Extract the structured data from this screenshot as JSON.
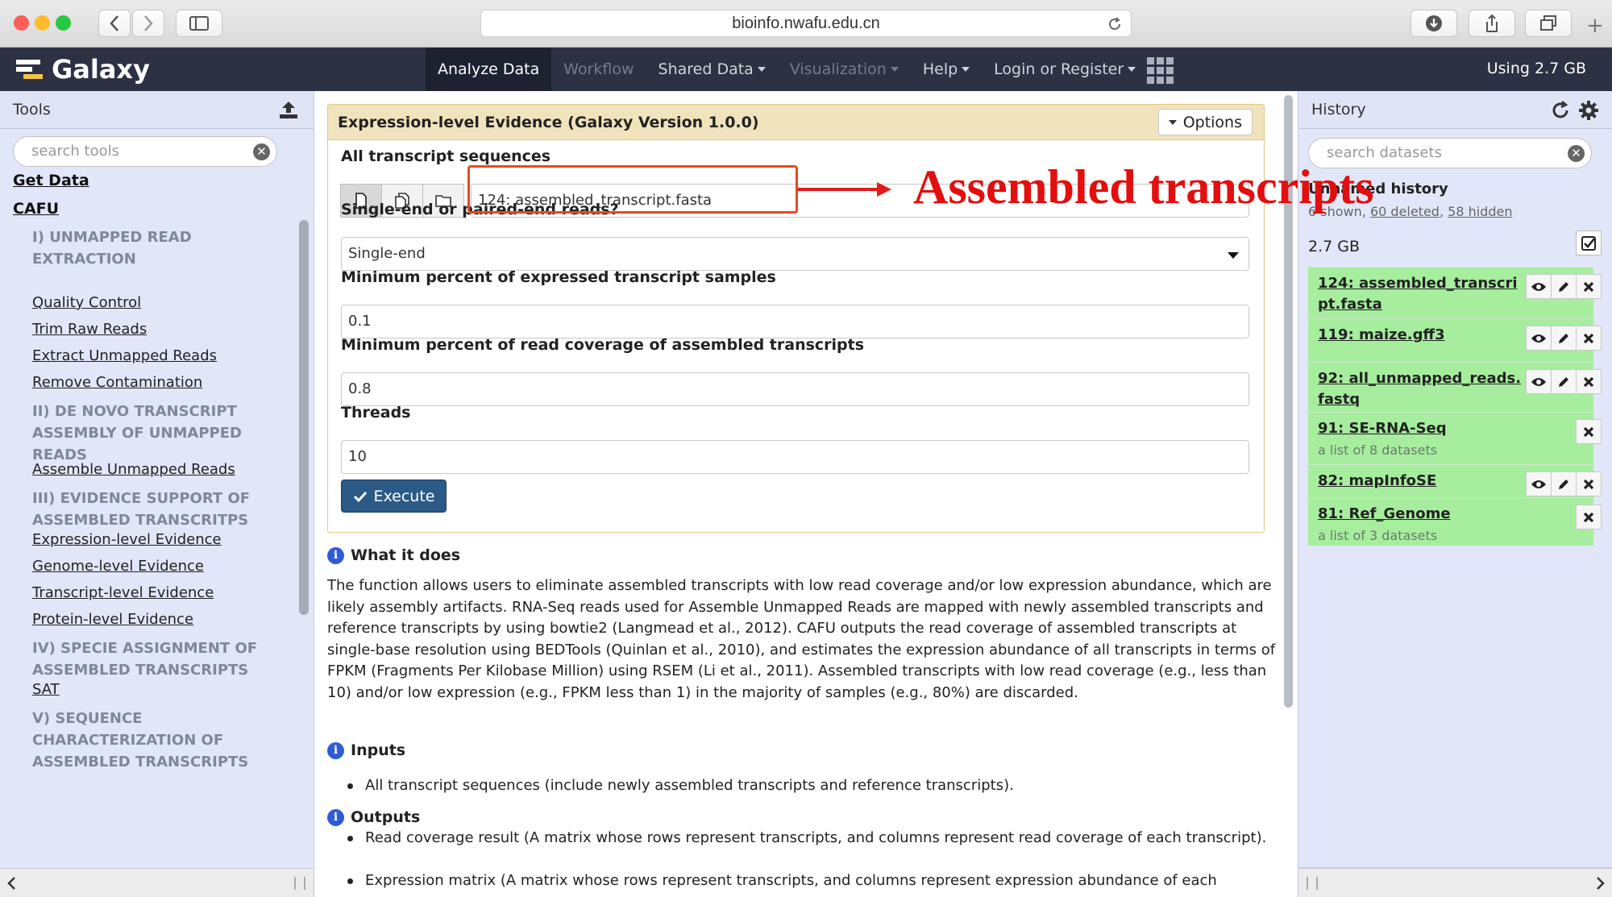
{
  "browser": {
    "url": "bioinfo.nwafu.edu.cn",
    "colors": {
      "close": "#fc5f57",
      "minimize": "#fdbc2e",
      "zoom": "#28c840"
    }
  },
  "navbar": {
    "brand": "Galaxy",
    "items": [
      {
        "label": "Analyze Data",
        "state": "active",
        "dropdown": false
      },
      {
        "label": "Workflow",
        "state": "disabled",
        "dropdown": false
      },
      {
        "label": "Shared Data",
        "state": "normal",
        "dropdown": true
      },
      {
        "label": "Visualization",
        "state": "disabled",
        "dropdown": true
      },
      {
        "label": "Help",
        "state": "normal",
        "dropdown": true
      },
      {
        "label": "Login or Register",
        "state": "normal",
        "dropdown": true
      }
    ],
    "quota": "Using 2.7 GB"
  },
  "tools_panel": {
    "title": "Tools",
    "search_placeholder": "search tools",
    "items": [
      {
        "kind": "header",
        "label": "Get Data"
      },
      {
        "kind": "header",
        "label": "CAFU"
      },
      {
        "kind": "section",
        "label": "I) UNMAPPED READ EXTRACTION"
      },
      {
        "kind": "tool",
        "label": "Quality Control"
      },
      {
        "kind": "tool",
        "label": "Trim Raw Reads"
      },
      {
        "kind": "tool",
        "label": "Extract Unmapped Reads"
      },
      {
        "kind": "tool",
        "label": "Remove Contamination"
      },
      {
        "kind": "section",
        "label": "II) DE NOVO TRANSCRIPT ASSEMBLY OF UNMAPPED READS"
      },
      {
        "kind": "tool",
        "label": "Assemble Unmapped Reads"
      },
      {
        "kind": "section",
        "label": "III) EVIDENCE SUPPORT OF ASSEMBLED TRANSCRITPS"
      },
      {
        "kind": "tool",
        "label": "Expression-level Evidence"
      },
      {
        "kind": "tool",
        "label": "Genome-level Evidence"
      },
      {
        "kind": "tool",
        "label": "Transcript-level Evidence"
      },
      {
        "kind": "tool",
        "label": "Protein-level Evidence"
      },
      {
        "kind": "section",
        "label": "IV) SPECIE ASSIGNMENT OF ASSEMBLED TRANSCRIPTS"
      },
      {
        "kind": "tool",
        "label": "SAT"
      },
      {
        "kind": "section",
        "label": "V) SEQUENCE CHARACTERIZATION OF ASSEMBLED TRANSCRIPTS"
      }
    ]
  },
  "tool_form": {
    "title": "Expression-level Evidence (Galaxy Version 1.0.0)",
    "options_label": "Options",
    "fields": [
      {
        "label": "All transcript sequences",
        "value": "124: assembled_transcript.fasta"
      },
      {
        "label": "Single-end or paired-end reads?",
        "value": "Single-end"
      },
      {
        "label": "Minimum percent of expressed transcript samples",
        "value": "0.1"
      },
      {
        "label": "Minimum percent of read coverage of assembled transcripts",
        "value": "0.8"
      },
      {
        "label": "Threads",
        "value": "10"
      }
    ],
    "execute_label": "Execute"
  },
  "annotation": {
    "text": "Assembled transcripts",
    "color": "#e30e0e"
  },
  "help": {
    "what_title": "What it does",
    "description": "The function allows users to eliminate assembled transcripts with low read coverage and/or low expression abundance, which are likely assembly artifacts. RNA-Seq reads used for Assemble Unmapped Reads are mapped with newly assembled transcripts and reference transcripts by using bowtie2 (Langmead et al., 2012). CAFU outputs the read coverage of assembled transcripts at single-base resolution using BEDTools (Quinlan et al., 2010), and estimates the expression abundance of all transcripts in terms of FPKM (Fragments Per Kilobase Million) using RSEM (Li et al., 2011). Assembled transcripts with low read coverage (e.g., less than 10) and/or low expression (e.g., FPKM less than 1) in the majority of samples (e.g., 80%) are discarded.",
    "inputs_title": "Inputs",
    "inputs": [
      "All transcript sequences (include newly assembled transcripts and reference transcripts)."
    ],
    "outputs_title": "Outputs",
    "outputs": [
      "Read coverage result (A matrix whose rows represent transcripts, and columns represent read coverage of each transcript).",
      "Expression matrix (A matrix whose rows represent transcripts, and columns represent expression abundance of each"
    ]
  },
  "history_panel": {
    "title": "History",
    "search_placeholder": "search datasets",
    "history_name": "Unnamed history",
    "counts": {
      "shown": "6 shown,",
      "deleted": "60 deleted",
      "sep": ",",
      "hidden": "58 hidden"
    },
    "size": "2.7 GB",
    "items_color": "#a6ee9e",
    "items": [
      {
        "name_line1": "124: assembled_transcri",
        "name_line2": "pt.fasta",
        "subtitle": "",
        "actions": [
          "eye-icon",
          "pencil-icon",
          "delete-icon"
        ]
      },
      {
        "name_line1": "119: maize.gff3",
        "name_line2": "",
        "subtitle": "",
        "actions": [
          "eye-icon",
          "pencil-icon",
          "delete-icon"
        ]
      },
      {
        "name_line1": "92: all_unmapped_reads.",
        "name_line2": "fastq",
        "subtitle": "",
        "actions": [
          "eye-icon",
          "pencil-icon",
          "delete-icon"
        ]
      },
      {
        "name_line1": "91: SE-RNA-Seq",
        "name_line2": "",
        "subtitle": "a list of 8 datasets",
        "actions": [
          "delete-icon"
        ]
      },
      {
        "name_line1": "82: mapInfoSE",
        "name_line2": "",
        "subtitle": "",
        "actions": [
          "eye-icon",
          "pencil-icon",
          "delete-icon"
        ]
      },
      {
        "name_line1": "81: Ref_Genome",
        "name_line2": "",
        "subtitle": "a list of 3 datasets",
        "actions": [
          "delete-icon"
        ]
      }
    ]
  }
}
